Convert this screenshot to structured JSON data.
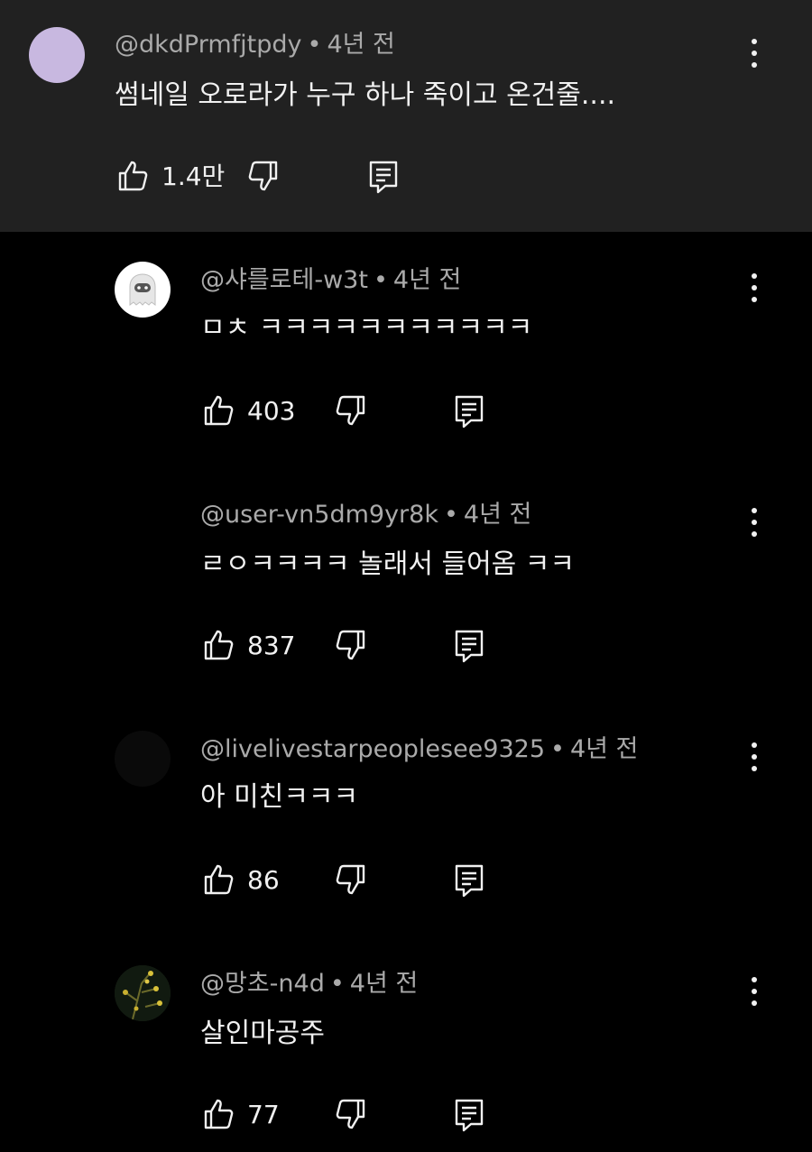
{
  "comments": [
    {
      "handle": "@dkdPrmfjtpdy",
      "separator": "•",
      "time": "4년 전",
      "text": "썸네일 오로라가 누구 하나 죽이고 온건줄....",
      "likes": "1.4만",
      "avatar_color": "#c8b8e0"
    },
    {
      "handle": "@샤를로테-w3t",
      "separator": "•",
      "time": "4년 전",
      "text": "ㅁㅊ ㅋㅋㅋㅋㅋㅋㅋㅋㅋㅋㅋ",
      "likes": "403",
      "avatar_color": "#ffffff"
    },
    {
      "handle": "@user-vn5dm9yr8k",
      "separator": "•",
      "time": "4년 전",
      "text": "ㄹㅇㅋㅋㅋㅋ 놀래서 들어옴 ㅋㅋ",
      "likes": "837",
      "avatar_color": "#000000"
    },
    {
      "handle": "@livelivestarpeoplesee9325",
      "separator": "•",
      "time": "4년 전",
      "text": "아 미친ㅋㅋㅋ",
      "likes": "86",
      "avatar_color": "#0a0a0a"
    },
    {
      "handle": "@망초-n4d",
      "separator": "•",
      "time": "4년 전",
      "text": "살인마공주",
      "likes": "77",
      "avatar_color": "#1a2418"
    }
  ],
  "icons": {
    "like": "thumbs-up-icon",
    "dislike": "thumbs-down-icon",
    "reply": "reply-icon",
    "menu": "more-vert-icon"
  }
}
